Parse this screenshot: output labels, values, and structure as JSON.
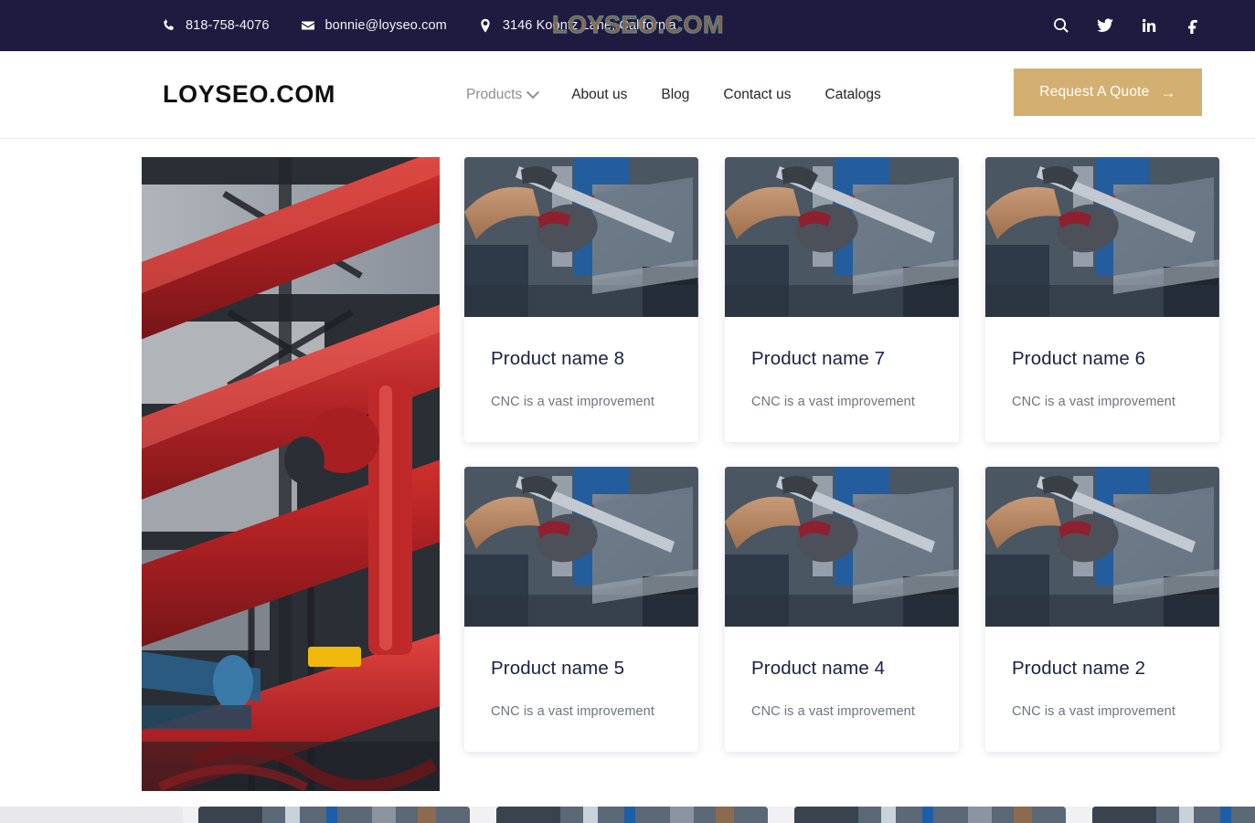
{
  "topbar": {
    "phone": "818-758-4076",
    "email": "bonnie@loyseo.com",
    "address": "3146 Koontz Lane, California",
    "watermark": "LOYSEO.COM",
    "icons": {
      "phone": "phone-icon",
      "email": "envelope-icon",
      "address": "map-pin-icon",
      "search": "search-icon",
      "twitter": "twitter-icon",
      "linkedin": "linkedin-icon",
      "facebook": "facebook-icon"
    },
    "background_color": "#1f1b40"
  },
  "header": {
    "logo": "LOYSEO.COM",
    "nav": [
      {
        "label": "Products",
        "has_dropdown": true,
        "state": "muted"
      },
      {
        "label": "About us",
        "has_dropdown": false,
        "state": "normal"
      },
      {
        "label": "Blog",
        "has_dropdown": false,
        "state": "normal"
      },
      {
        "label": "Contact us",
        "has_dropdown": false,
        "state": "normal"
      },
      {
        "label": "Catalogs",
        "has_dropdown": false,
        "state": "normal"
      }
    ],
    "cta": {
      "label": "Request A Quote",
      "arrow": "→",
      "color": "#d3b072"
    }
  },
  "main": {
    "feature_image_alt": "red industrial pipes and valves",
    "products": [
      {
        "title": "Product name 8",
        "desc": "CNC is a vast improvement",
        "image_alt": "worker in gloves bending sheet metal on press brake"
      },
      {
        "title": "Product name 7",
        "desc": "CNC is a vast improvement",
        "image_alt": "worker in gloves bending sheet metal on press brake"
      },
      {
        "title": "Product name 6",
        "desc": "CNC is a vast improvement",
        "image_alt": "worker in gloves bending sheet metal on press brake"
      },
      {
        "title": "Product name 5",
        "desc": "CNC is a vast improvement",
        "image_alt": "worker in gloves bending sheet metal on press brake"
      },
      {
        "title": "Product name 4",
        "desc": "CNC is a vast improvement",
        "image_alt": "worker in gloves bending sheet metal on press brake"
      },
      {
        "title": "Product name 2",
        "desc": "CNC is a vast improvement",
        "image_alt": "worker in gloves bending sheet metal on press brake"
      }
    ],
    "title_color": "#1b2145",
    "desc_color": "#70737e"
  },
  "peek_section": {
    "background_color": "#f1f1f3",
    "card_count": 4
  }
}
